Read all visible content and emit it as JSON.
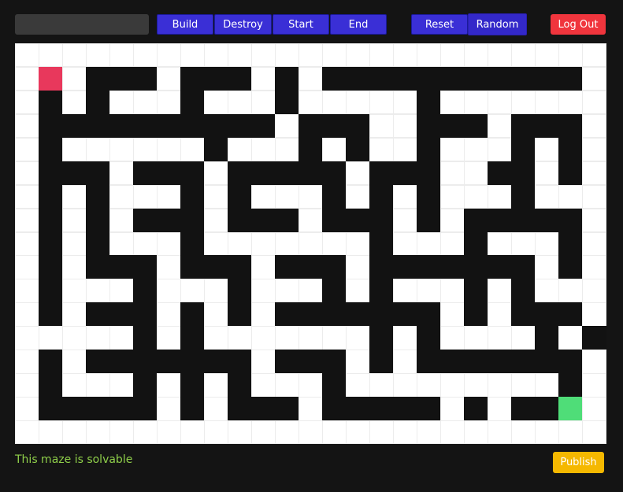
{
  "toolbar": {
    "name_value": "",
    "build_label": "Build",
    "destroy_label": "Destroy",
    "start_label": "Start",
    "end_label": "End",
    "reset_label": "Reset",
    "random_label": "Random",
    "logout_label": "Log Out"
  },
  "maze": {
    "cols": 25,
    "rows": 17,
    "grid": [
      ".........................",
      ".S.###.###.#.###########.",
      ".#.#...#...#.....#.......",
      ".##########.###..###.###.",
      ".#......#...#.#..#...#.#.",
      ".###.###.#####.###..##.#.",
      ".#.#...#.#...#.#.#...#...",
      ".#.#.###.###.###.#.#####.",
      ".#.#...#.......#...#...#.",
      ".#.###.###.###.#######.#.",
      ".#...#...#...#.#...#.#...",
      ".#.###.#.#.#######.#.###.",
      ".....#.#.......#.#....#.#.",
      ".#.#######.###.#.#######.",
      ".#...#.#.#...#.........#.",
      ".#####.#.###.#####.#.##E.",
      "........................."
    ],
    "colors": {
      "wall": "#121212",
      "open": "#ffffff",
      "start": "#e8385c",
      "end": "#4fdd78"
    }
  },
  "status": {
    "message": "This maze is solvable",
    "color": "#8fcf4a"
  },
  "publish_label": "Publish"
}
